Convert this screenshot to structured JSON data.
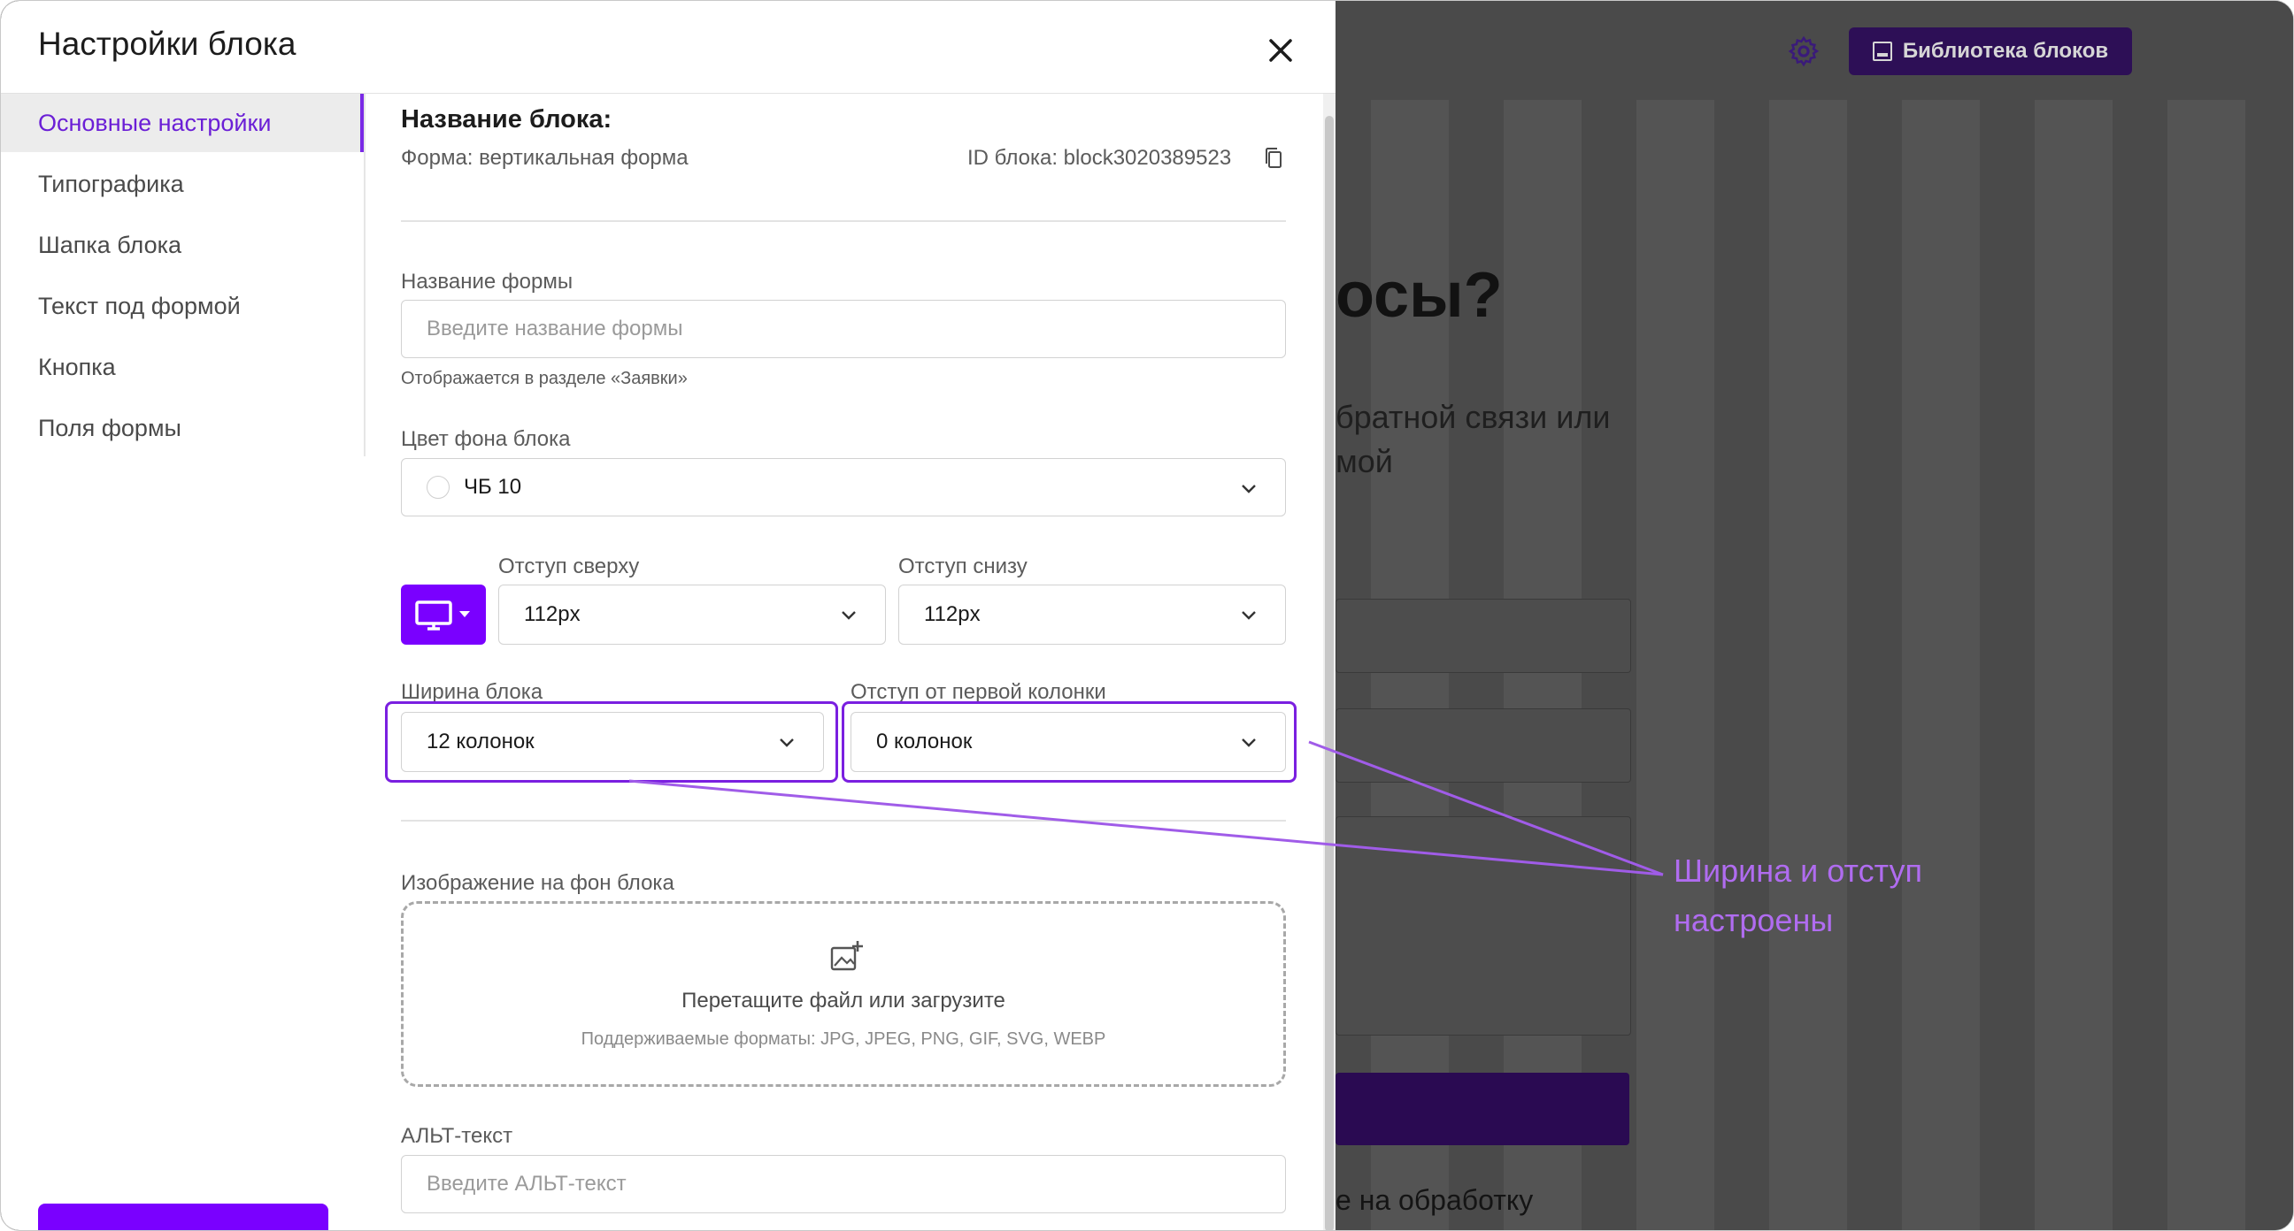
{
  "background": {
    "library_button_label": "Библиотека блоков",
    "heading_fragment": "осы?",
    "subtext_line1": "братной связи или",
    "subtext_line2": "мой",
    "consent_fragment": "е на обработку"
  },
  "modal": {
    "title": "Настройки блока"
  },
  "sidebar": {
    "items": [
      {
        "label": "Основные настройки",
        "active": true
      },
      {
        "label": "Типографика",
        "active": false
      },
      {
        "label": "Шапка блока",
        "active": false
      },
      {
        "label": "Текст под формой",
        "active": false
      },
      {
        "label": "Кнопка",
        "active": false
      },
      {
        "label": "Поля формы",
        "active": false
      }
    ]
  },
  "main": {
    "block_name_title": "Название блока:",
    "form_type": "Форма: вертикальная форма",
    "block_id": "ID блока: block3020389523",
    "form_name": {
      "label": "Название формы",
      "placeholder": "Введите название формы",
      "hint": "Отображается в разделе «Заявки»"
    },
    "bg_color": {
      "label": "Цвет фона блока",
      "value": "ЧБ 10"
    },
    "padding_top": {
      "label": "Отступ сверху",
      "value": "112px"
    },
    "padding_bottom": {
      "label": "Отступ снизу",
      "value": "112px"
    },
    "block_width": {
      "label": "Ширина блока",
      "value": "12 колонок"
    },
    "first_column_offset": {
      "label": "Отступ от первой колонки",
      "value": "0 колонок"
    },
    "bg_image": {
      "label": "Изображение на фон блока",
      "upload_title": "Перетащите файл или загрузите",
      "upload_formats": "Поддерживаемые форматы: JPG, JPEG, PNG, GIF, SVG, WEBP"
    },
    "alt_text": {
      "label": "АЛЬТ-текст",
      "placeholder": "Введите АЛЬТ-текст"
    }
  },
  "annotation": {
    "text": "Ширина и отступ\nнастроены"
  },
  "colors": {
    "accent": "#7a00ff",
    "highlight": "#7a1fe0",
    "annotation": "#b06cf0"
  }
}
